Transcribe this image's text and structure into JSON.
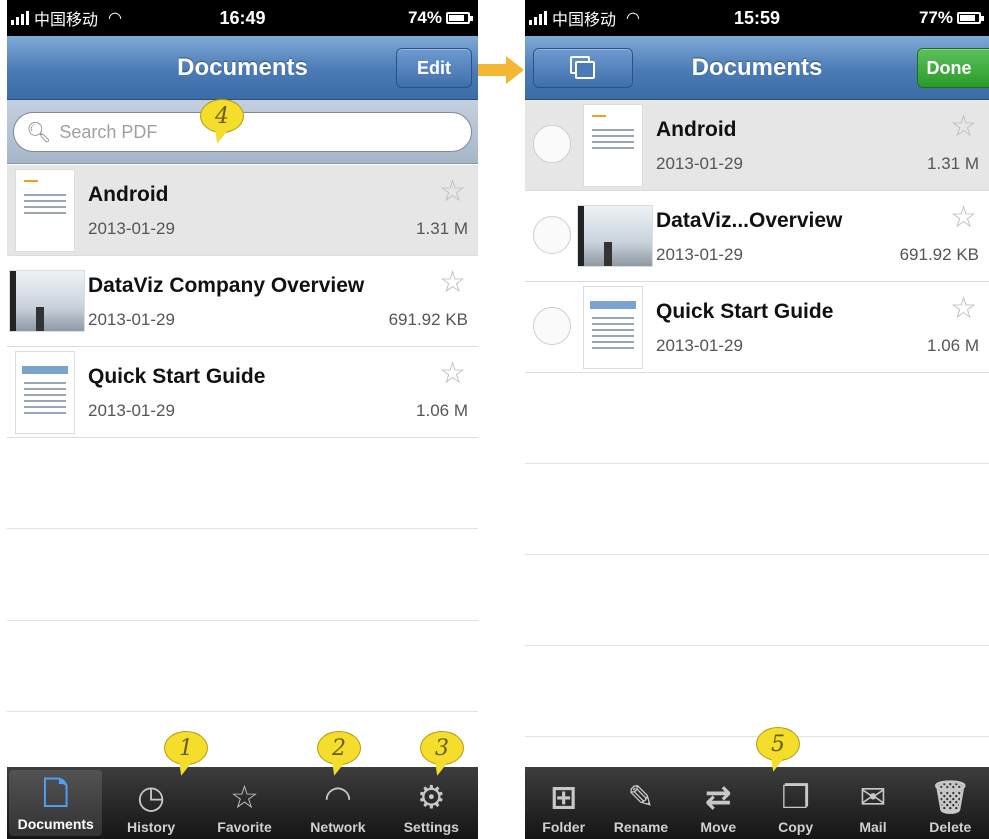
{
  "left": {
    "status": {
      "carrier": "中国移动",
      "time": "16:49",
      "battery": "74%",
      "battery_level": 0.74
    },
    "nav": {
      "title": "Documents",
      "edit": "Edit"
    },
    "search": {
      "placeholder": "Search PDF"
    },
    "docs": [
      {
        "title": "Android",
        "date": "2013-01-29",
        "size": "1.31 M"
      },
      {
        "title": "DataViz Company Overview",
        "date": "2013-01-29",
        "size": "691.92 KB"
      },
      {
        "title": "Quick Start Guide",
        "date": "2013-01-29",
        "size": "1.06 M"
      }
    ],
    "tabs": [
      {
        "label": "Documents",
        "icon": "document-icon"
      },
      {
        "label": "History",
        "icon": "clock-icon"
      },
      {
        "label": "Favorite",
        "icon": "star-icon"
      },
      {
        "label": "Network",
        "icon": "wifi-icon"
      },
      {
        "label": "Settings",
        "icon": "gear-icon"
      }
    ],
    "badges": [
      "1",
      "2",
      "3",
      "4"
    ]
  },
  "right": {
    "status": {
      "carrier": "中国移动",
      "time": "15:59",
      "battery": "77%",
      "battery_level": 0.77
    },
    "nav": {
      "title": "Documents",
      "done": "Done"
    },
    "docs": [
      {
        "title": "Android",
        "date": "2013-01-29",
        "size": "1.31 M"
      },
      {
        "title": "DataViz...Overview",
        "date": "2013-01-29",
        "size": "691.92 KB"
      },
      {
        "title": "Quick Start Guide",
        "date": "2013-01-29",
        "size": "1.06 M"
      }
    ],
    "tools": [
      {
        "label": "Folder",
        "icon": "new-folder-icon"
      },
      {
        "label": "Rename",
        "icon": "rename-icon"
      },
      {
        "label": "Move",
        "icon": "move-icon"
      },
      {
        "label": "Copy",
        "icon": "copy-icon"
      },
      {
        "label": "Mail",
        "icon": "mail-icon"
      },
      {
        "label": "Delete",
        "icon": "trash-icon"
      }
    ],
    "badges": [
      "5"
    ]
  },
  "colors": {
    "nav_blue": "#4a7bb6",
    "done_green": "#2b9a2a",
    "badge_yellow": "#f4de2b",
    "active_tab": "#4fa3f7"
  }
}
